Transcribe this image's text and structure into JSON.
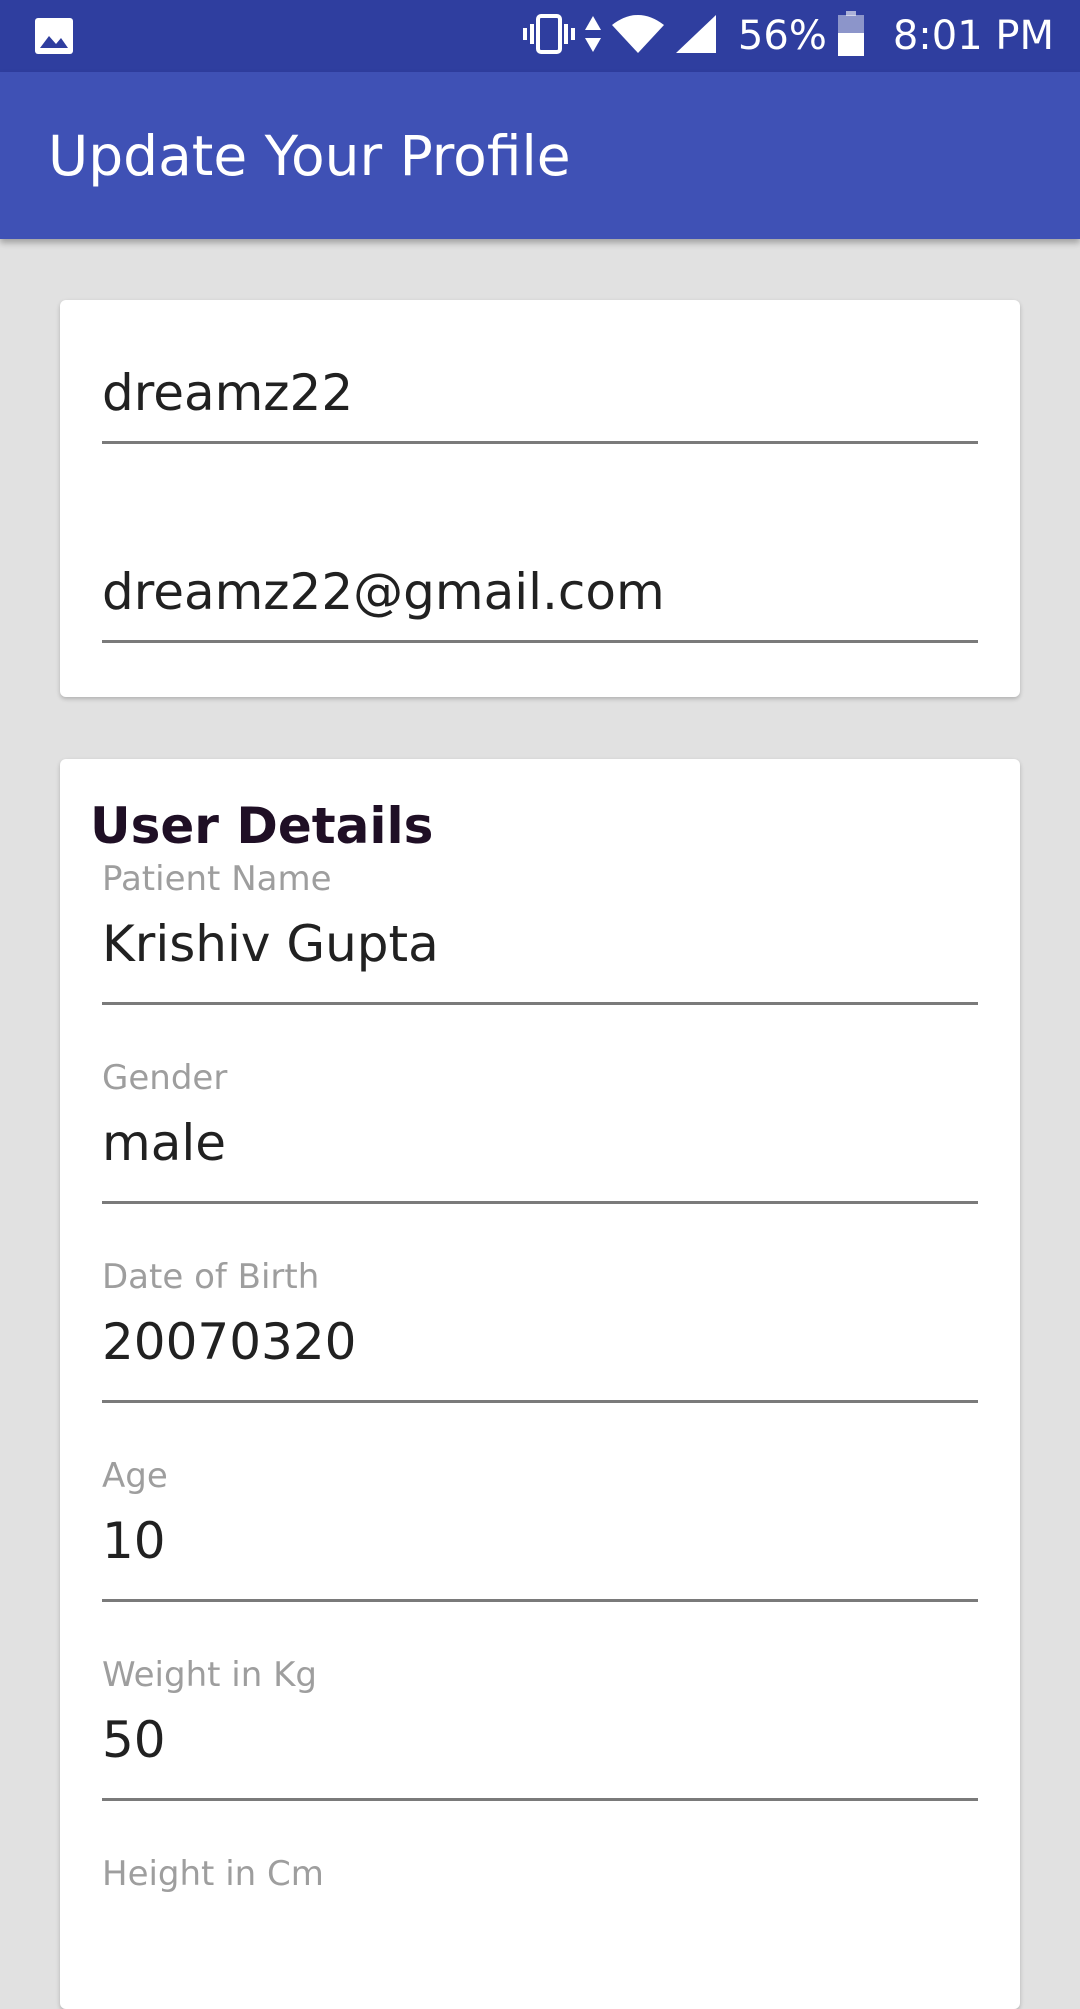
{
  "status_bar": {
    "battery": "56%",
    "time": "8:01 PM",
    "icons": [
      "image-icon",
      "vibrate-icon",
      "data-arrows-icon",
      "wifi-icon",
      "signal-icon",
      "battery-icon"
    ]
  },
  "app_bar": {
    "title": "Update Your Profile",
    "color": "#3f51b5",
    "status_color": "#2f3e9f"
  },
  "account": {
    "username": "dreamz22",
    "email": "dreamz22@gmail.com"
  },
  "user_details": {
    "title": "User Details",
    "fields": [
      {
        "label": "Patient Name",
        "value": "Krishiv Gupta"
      },
      {
        "label": "Gender",
        "value": "male"
      },
      {
        "label": "Date of Birth",
        "value": "20070320"
      },
      {
        "label": "Age",
        "value": "10"
      },
      {
        "label": "Weight in Kg",
        "value": "50"
      },
      {
        "label": "Height in Cm",
        "value": ""
      }
    ]
  }
}
